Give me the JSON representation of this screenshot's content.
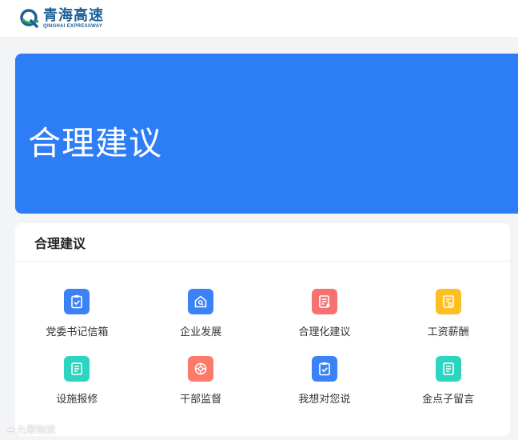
{
  "header": {
    "logo_cn": "青海高速",
    "logo_en": "QINGHAI EXPRESSWAY"
  },
  "banner": {
    "title": "合理建议"
  },
  "section": {
    "title": "合理建议",
    "items": [
      {
        "label": "党委书记信箱",
        "icon": "clipboard-check-icon",
        "color": "#3b82f6"
      },
      {
        "label": "企业发展",
        "icon": "house-search-icon",
        "color": "#3b82f6"
      },
      {
        "label": "合理化建议",
        "icon": "document-edit-icon",
        "color": "#f87171"
      },
      {
        "label": "工资薪酬",
        "icon": "receipt-icon",
        "color": "#fbbf24"
      },
      {
        "label": "设施报修",
        "icon": "document-list-icon",
        "color": "#2dd4bf"
      },
      {
        "label": "干部监督",
        "icon": "radar-icon",
        "color": "#fb7a6a"
      },
      {
        "label": "我想对您说",
        "icon": "clipboard-check-icon",
        "color": "#3b82f6"
      },
      {
        "label": "金点子留言",
        "icon": "document-list-icon",
        "color": "#2dd4bf"
      }
    ]
  },
  "watermark": {
    "text": "九歌物流"
  }
}
